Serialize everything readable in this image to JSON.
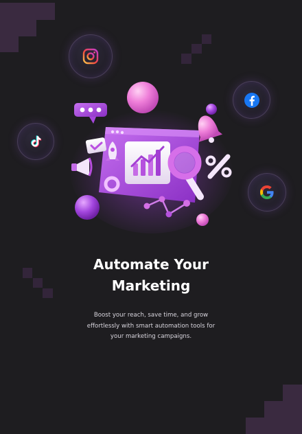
{
  "onboarding": {
    "title_lines": [
      "Automate Your",
      "Marketing"
    ],
    "description_lines": [
      "Boost your reach, save time, and grow",
      "effortlessly with smart automation tools for",
      "your marketing campaigns."
    ]
  },
  "icons": {
    "social": [
      "instagram-icon",
      "facebook-icon",
      "tiktok-icon",
      "google-icon"
    ],
    "illustration": [
      "chat-bubble-icon",
      "bell-icon",
      "megaphone-icon",
      "rocket-icon",
      "magnifier-icon",
      "percent-icon",
      "bar-chart-icon",
      "checkmark-icon"
    ]
  },
  "colors": {
    "background": "#1e1d20",
    "accent": "#b44ee0",
    "pixel_decoration": "#3a2a40"
  }
}
